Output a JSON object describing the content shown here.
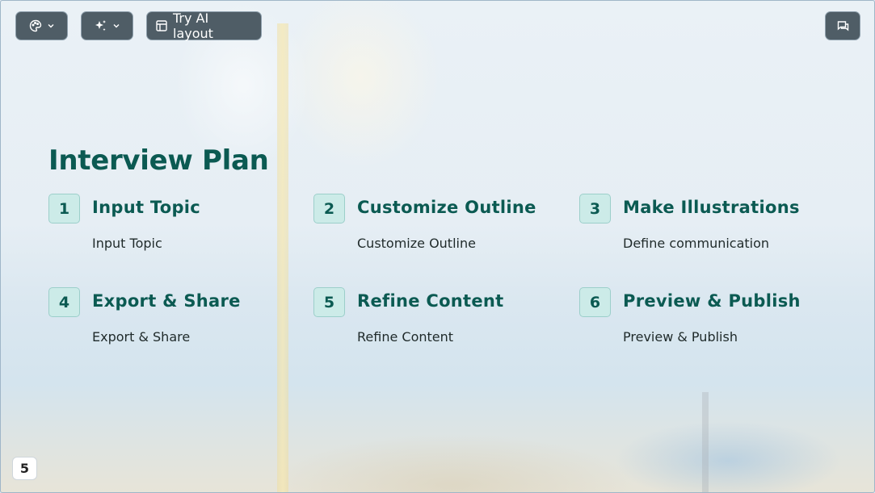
{
  "toolbar": {
    "theme_icon": "palette-icon",
    "ai_icon": "sparkle-icon",
    "layout_icon": "layout-icon",
    "layout_label": "Try AI layout",
    "comment_icon": "comment-icon"
  },
  "slide": {
    "title": "Interview Plan",
    "steps": [
      {
        "num": "1",
        "title": "Input Topic",
        "desc": "Input Topic"
      },
      {
        "num": "2",
        "title": "Customize Outline",
        "desc": "Customize Outline"
      },
      {
        "num": "3",
        "title": "Make Illustrations",
        "desc": "Define communication"
      },
      {
        "num": "4",
        "title": "Export & Share",
        "desc": "Export & Share"
      },
      {
        "num": "5",
        "title": "Refine Content",
        "desc": "Refine Content"
      },
      {
        "num": "6",
        "title": "Preview & Publish",
        "desc": "Preview & Publish"
      }
    ],
    "page_number": "5"
  },
  "colors": {
    "accent": "#0b5a52",
    "badge_bg": "#ccebe8",
    "toolbar_bg": "#4f5d66"
  }
}
